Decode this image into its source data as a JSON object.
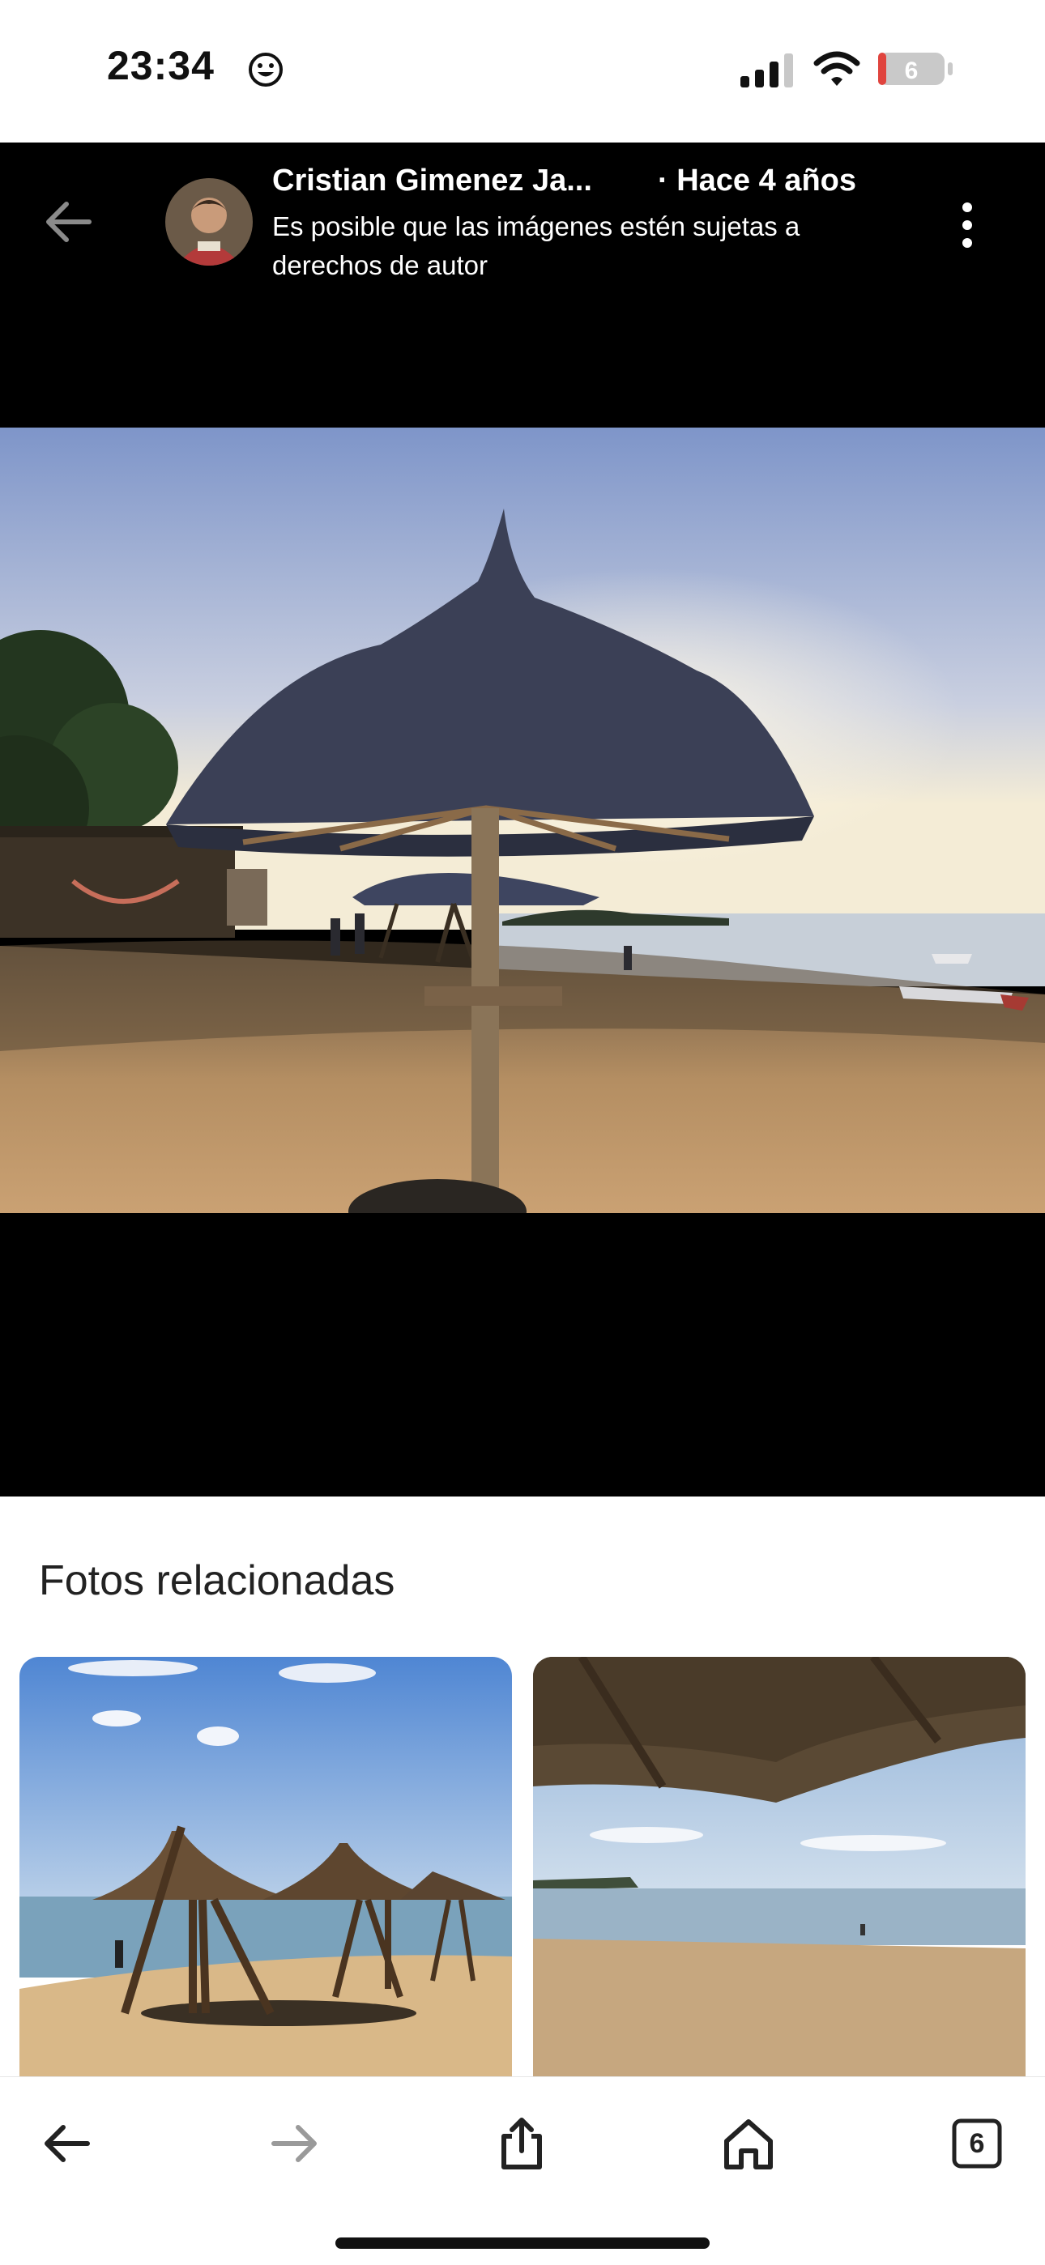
{
  "status_bar": {
    "time": "23:34",
    "battery_level": "6",
    "icons": [
      "emoji-face-icon",
      "cellular-signal-icon",
      "wifi-icon",
      "battery-icon"
    ]
  },
  "viewer": {
    "author": "Cristian Gimenez Ja...",
    "time_ago": "· Hace 4 años",
    "notice": "Es posible que las imágenes estén sujetas a derechos de autor",
    "background": "#000000"
  },
  "related": {
    "title": "Fotos relacionadas"
  },
  "toolbar": {
    "tabs_count": "6",
    "icons": [
      "back-arrow-icon",
      "forward-arrow-icon",
      "share-icon",
      "home-icon",
      "tabs-icon"
    ]
  },
  "colors": {
    "accent": "#111111",
    "disabled": "#9a9a9a"
  }
}
